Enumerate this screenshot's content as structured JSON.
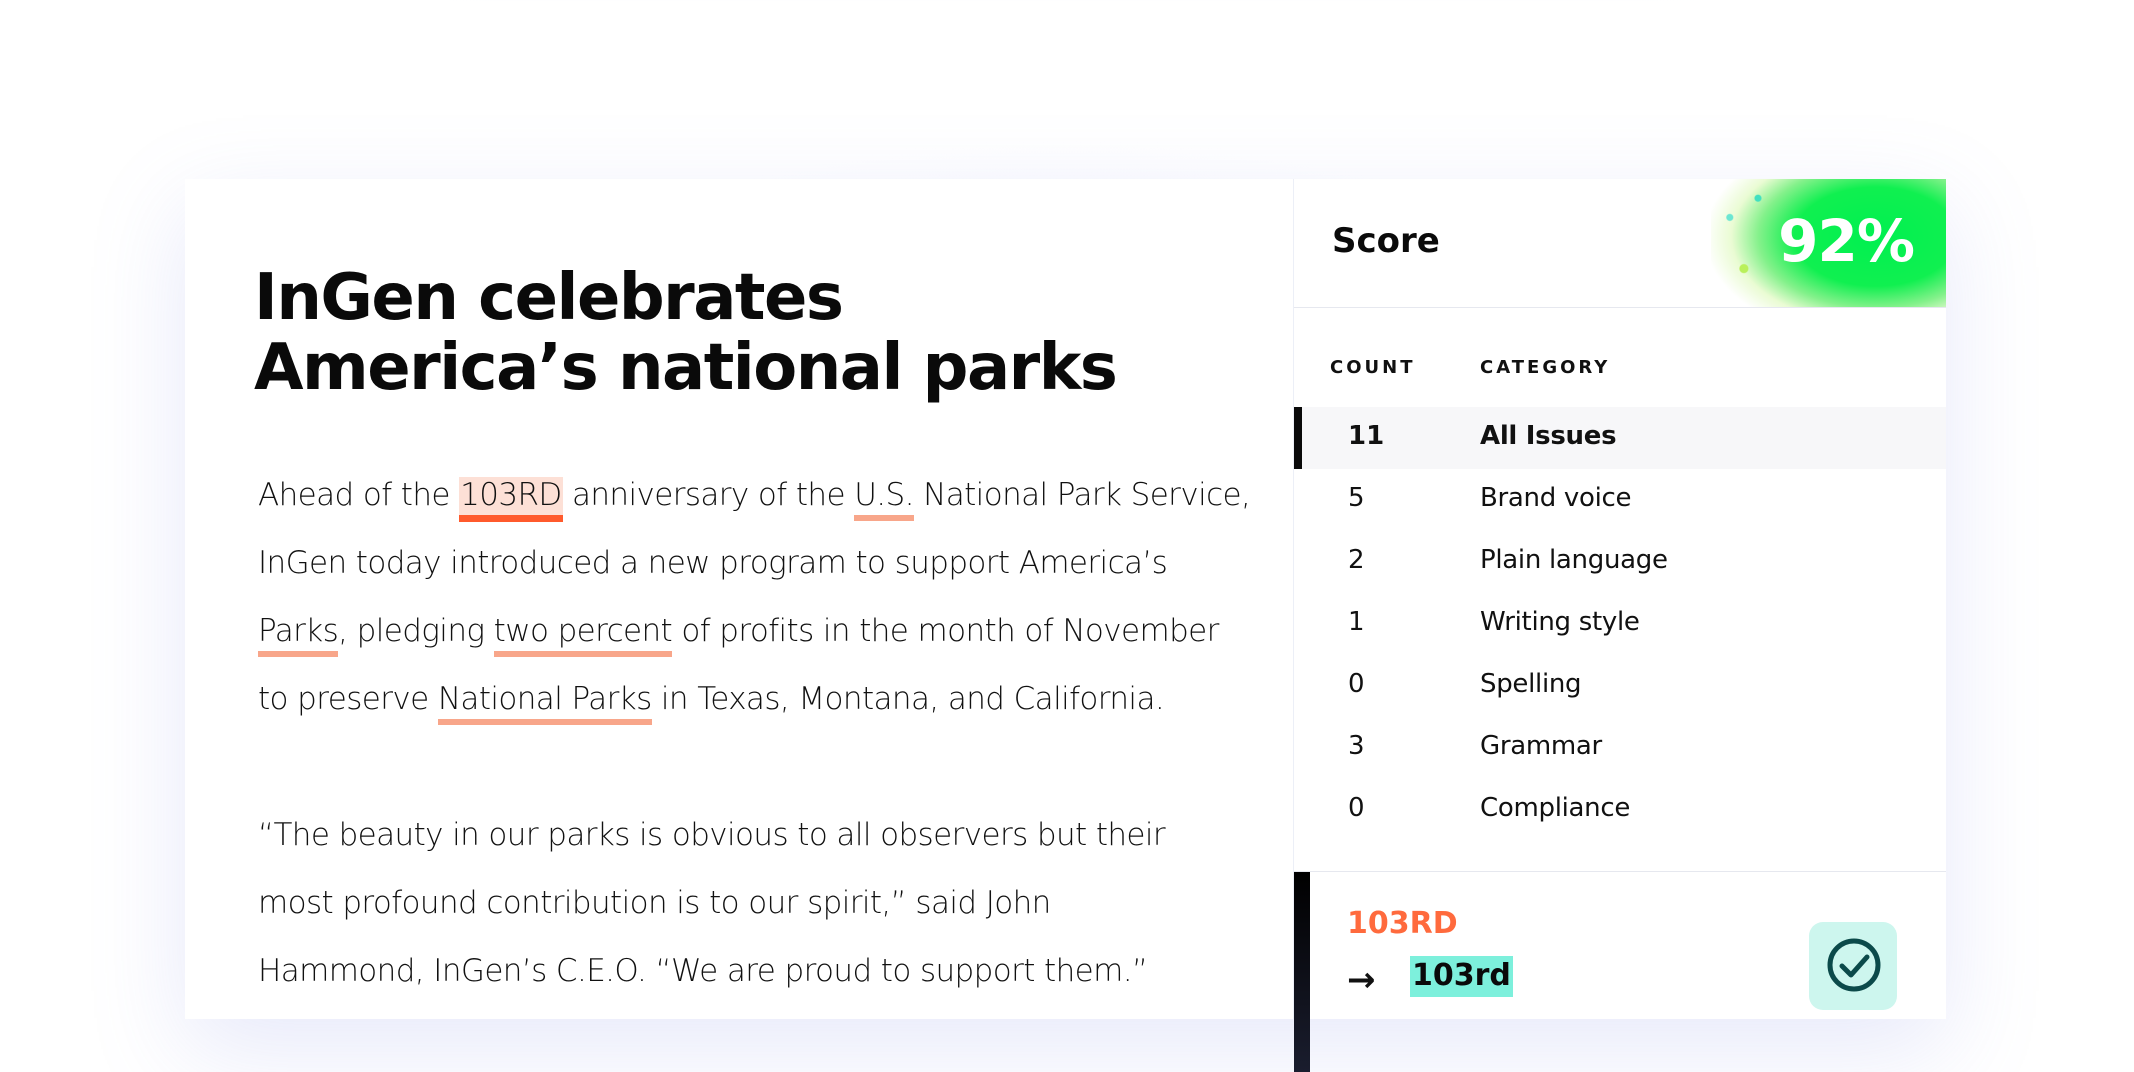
{
  "document": {
    "title_line1": "InGen celebrates",
    "title_line2": "America’s national parks",
    "paragraph1": {
      "l1_a": "Ahead of the ",
      "l1_h1": "103RD",
      "l1_b": " anniversary of the ",
      "l1_h2": "U.S.",
      "l1_c": " National Park Service,",
      "l2": "InGen today introduced a new program to support America’s",
      "l3_h1": "Parks",
      "l3_a": ", pledging ",
      "l3_h2": "two percent",
      "l3_b": " of profits in the month of November",
      "l4_a": "to preserve ",
      "l4_h1": "National Parks",
      "l4_b": " in Texas, Montana, and California."
    },
    "paragraph2": {
      "l1": "“The beauty in our parks is obvious to all observers but their",
      "l2": "most profound contribution is to our spirit,” said John",
      "l3": "Hammond, InGen’s C.E.O. “We are proud to support them.”"
    }
  },
  "score_panel": {
    "label": "Score",
    "value": "92%",
    "columns": {
      "count": "COUNT",
      "category": "CATEGORY"
    },
    "rows": [
      {
        "count": "11",
        "category": "All Issues"
      },
      {
        "count": "5",
        "category": "Brand voice"
      },
      {
        "count": "2",
        "category": "Plain language"
      },
      {
        "count": "1",
        "category": "Writing style"
      },
      {
        "count": "0",
        "category": "Spelling"
      },
      {
        "count": "3",
        "category": "Grammar"
      },
      {
        "count": "0",
        "category": "Compliance"
      }
    ],
    "issue": {
      "term": "103RD",
      "arrow": "→",
      "suggestion": "103rd",
      "accept_icon": "check-circle-icon"
    }
  },
  "colors": {
    "highlight_underline": "#f8a68a",
    "active_highlight": "#ff5a2c",
    "score_green": "#00f050",
    "suggestion_bg": "#7df0dc",
    "issue_term": "#ff6a3d"
  }
}
